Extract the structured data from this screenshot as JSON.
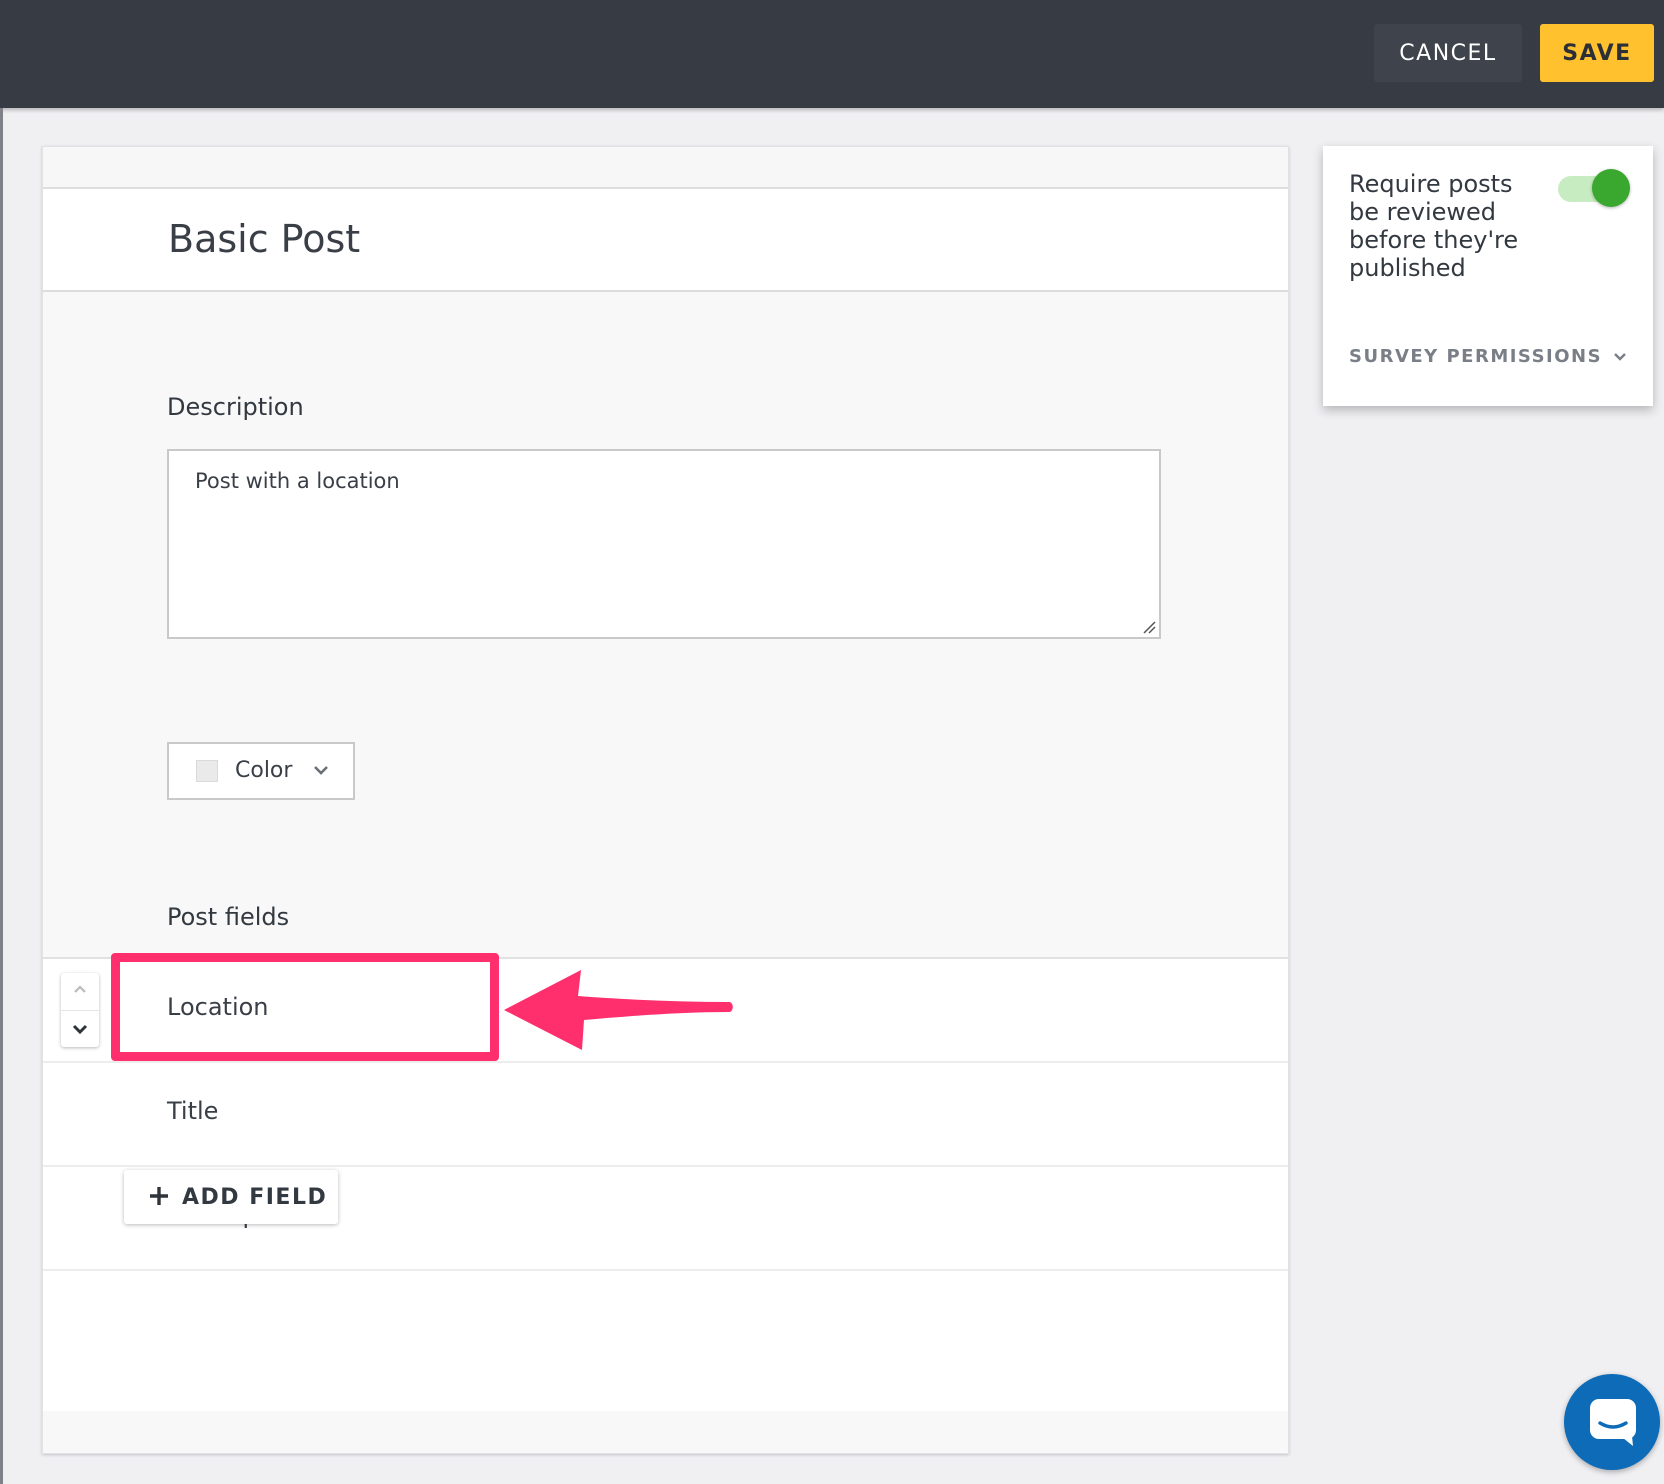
{
  "header": {
    "cancel_label": "CANCEL",
    "save_label": "SAVE"
  },
  "form": {
    "title": "Basic Post",
    "description_label": "Description",
    "description_value": "Post with a location",
    "color_label": "Color",
    "post_fields_label": "Post fields",
    "fields": [
      {
        "label": "Location"
      },
      {
        "label": "Title"
      },
      {
        "label": "Description"
      }
    ],
    "add_field_label": "ADD FIELD"
  },
  "settings": {
    "require_review_text": "Require posts be reviewed before they're published",
    "require_review_enabled": true,
    "survey_permissions_label": "SURVEY PERMISSIONS"
  },
  "colors": {
    "topbar": "#363b44",
    "save_button": "#ffc12e",
    "toggle_on": "#3aa72f",
    "annotation": "#ff2f6d",
    "chat_button": "#0d6bb8"
  },
  "icons": [
    "chevron-up-icon",
    "chevron-down-icon",
    "plus-icon",
    "resize-handle-icon",
    "chat-icon"
  ]
}
